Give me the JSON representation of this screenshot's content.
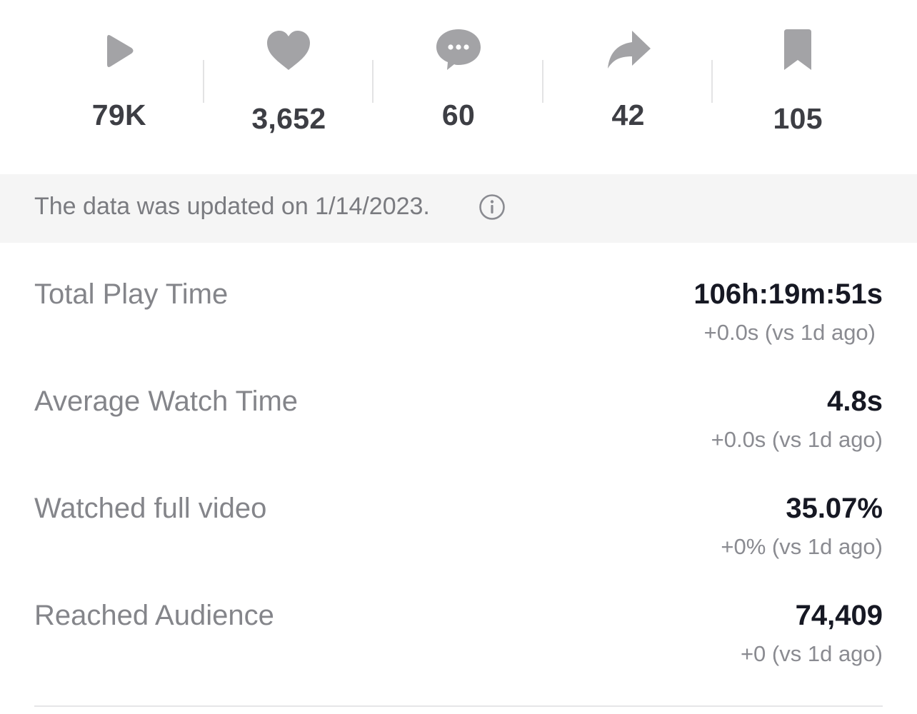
{
  "stats": [
    {
      "icon": "play-icon",
      "value": "79K"
    },
    {
      "icon": "heart-icon",
      "value": "3,652"
    },
    {
      "icon": "comment-icon",
      "value": "60"
    },
    {
      "icon": "share-icon",
      "value": "42"
    },
    {
      "icon": "bookmark-icon",
      "value": "105"
    }
  ],
  "banner": {
    "text": "The data was updated on 1/14/2023.",
    "icon": "info-icon"
  },
  "metrics": [
    {
      "label": "Total Play Time",
      "value": "106h:19m:51s",
      "change": "+0.0s (vs 1d ago)"
    },
    {
      "label": "Average Watch Time",
      "value": "4.8s",
      "change": "+0.0s (vs 1d ago)"
    },
    {
      "label": "Watched full video",
      "value": "35.07%",
      "change": "+0% (vs 1d ago)"
    },
    {
      "label": "Reached Audience",
      "value": "74,409",
      "change": "+0 (vs 1d ago)"
    }
  ],
  "colors": {
    "icon_gray": "#a3a3a6",
    "count_text": "#3d3e44",
    "banner_bg": "#f5f5f5",
    "label_text": "#84858a",
    "value_text": "#161823"
  }
}
